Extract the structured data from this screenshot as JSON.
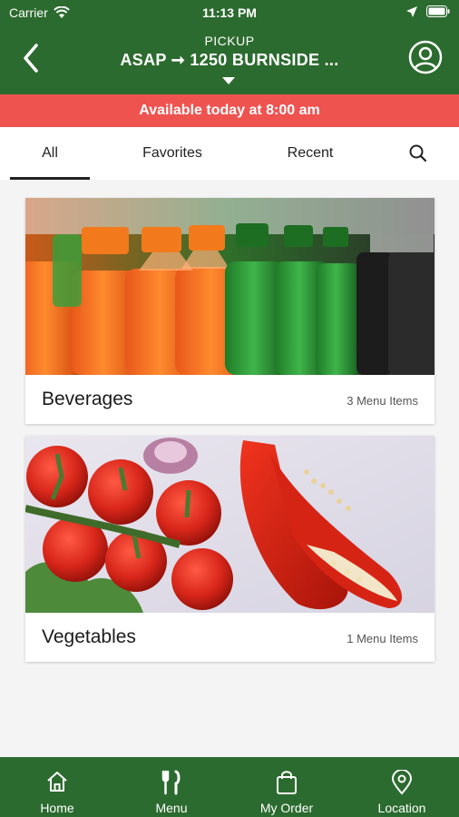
{
  "status_bar": {
    "carrier": "Carrier",
    "time": "11:13 PM"
  },
  "header": {
    "mode": "PICKUP",
    "destination": "ASAP ➞ 1250 BURNSIDE ..."
  },
  "banner": {
    "text": "Available today at 8:00 am",
    "color": "#ef5350"
  },
  "tabs": [
    {
      "label": "All",
      "active": true
    },
    {
      "label": "Favorites",
      "active": false
    },
    {
      "label": "Recent",
      "active": false
    }
  ],
  "categories": [
    {
      "title": "Beverages",
      "count": "3 Menu Items"
    },
    {
      "title": "Vegetables",
      "count": "1 Menu Items"
    }
  ],
  "tab_bar": [
    {
      "label": "Home",
      "icon": "home-icon"
    },
    {
      "label": "Menu",
      "icon": "fork-knife-icon"
    },
    {
      "label": "My Order",
      "icon": "shopping-bag-icon"
    },
    {
      "label": "Location",
      "icon": "location-pin-icon"
    }
  ],
  "theme": {
    "primary": "#2c6b2f",
    "accent": "#ef5350"
  }
}
